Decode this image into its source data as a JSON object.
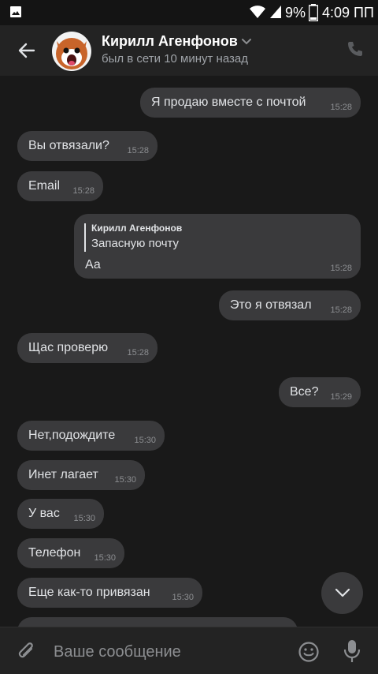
{
  "statusbar": {
    "battery_percent": "9%",
    "time": "4:09 ПП",
    "icons": [
      "image-icon",
      "wifi-icon",
      "signal-icon",
      "battery-icon"
    ]
  },
  "header": {
    "contact_name": "Кирилл Агенфонов",
    "last_seen": "был в сети 10 минут назад",
    "icons": [
      "back-arrow-icon",
      "chevron-down-icon",
      "phone-icon"
    ]
  },
  "messages": [
    {
      "direction": "out",
      "text": "Я продаю вместе с почтой",
      "time": "15:28"
    },
    {
      "direction": "in",
      "text": "Вы отвязали?",
      "time": "15:28"
    },
    {
      "direction": "in",
      "text": "Email",
      "time": "15:28"
    },
    {
      "direction": "out",
      "reply_author": "Кирилл Агенфонов",
      "reply_text": "Запасную почту",
      "text": "Аа",
      "time": "15:28"
    },
    {
      "direction": "out",
      "text": "Это я отвязал",
      "time": "15:28"
    },
    {
      "direction": "in",
      "text": "Щас проверю",
      "time": "15:28"
    },
    {
      "direction": "out",
      "text": "Все?",
      "time": "15:29"
    },
    {
      "direction": "in",
      "text": "Нет,подождите",
      "time": "15:30"
    },
    {
      "direction": "in",
      "text": "Инет лагает",
      "time": "15:30"
    },
    {
      "direction": "in",
      "text": "У вас",
      "time": "15:30"
    },
    {
      "direction": "in",
      "text": "Телефон",
      "time": "15:30"
    },
    {
      "direction": "in",
      "text": "Еще как-то привязан",
      "time": "15:30"
    }
  ],
  "composer": {
    "placeholder": "Ваше сообщение",
    "icons": [
      "attach-icon",
      "emoji-icon",
      "microphone-icon"
    ]
  },
  "scroll_down": {
    "icon": "chevron-down-icon"
  },
  "colors": {
    "background": "#191919",
    "bubble": "#3a3a3c",
    "header": "#232323",
    "text": "#e1e3e6",
    "secondary_text": "#9fa3a8"
  }
}
